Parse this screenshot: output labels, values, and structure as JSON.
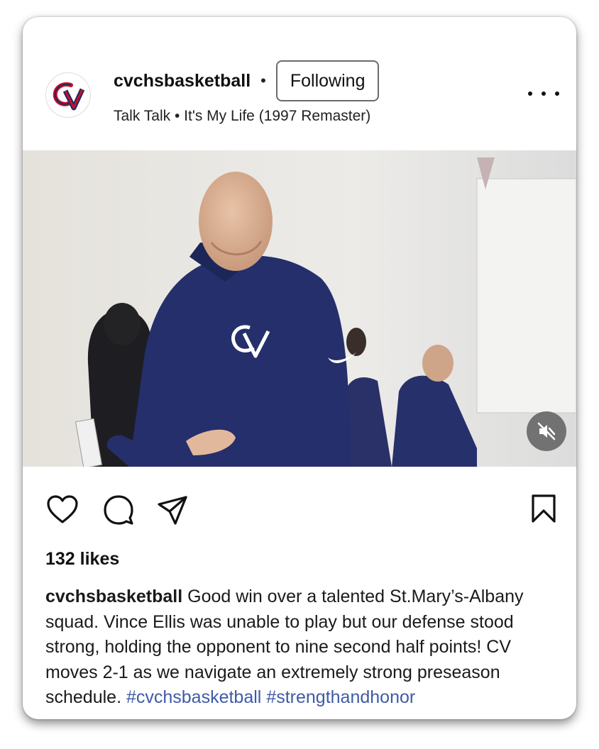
{
  "post": {
    "username": "cvchsbasketball",
    "separator": "•",
    "follow_label": "Following",
    "audio": "Talk Talk • It's My Life (1997 Remaster)",
    "avatar_logo_text": "CV",
    "more_icon": "more-horizontal-icon"
  },
  "media": {
    "type": "video",
    "muted": true,
    "mute_icon": "speaker-muted-icon"
  },
  "actions": {
    "like_icon": "heart-icon",
    "comment_icon": "comment-icon",
    "share_icon": "send-icon",
    "save_icon": "bookmark-icon"
  },
  "likes_text": "132 likes",
  "caption": {
    "username": "cvchsbasketball",
    "text": " Good win over a talented St.Mary’s-Albany squad. Vince Ellis was unable to play but our defense stood strong, holding the opponent to nine second half points! CV moves 2-1 as we navigate an extremely strong preseason schedule. ",
    "hashtags": [
      "#cvchsbasketball",
      "#strengthandhonor"
    ]
  },
  "colors": {
    "hashtag": "#3f5aa8",
    "logo_red": "#c8102e",
    "logo_navy": "#1f2a5c",
    "jacket_navy": "#242f6b"
  }
}
